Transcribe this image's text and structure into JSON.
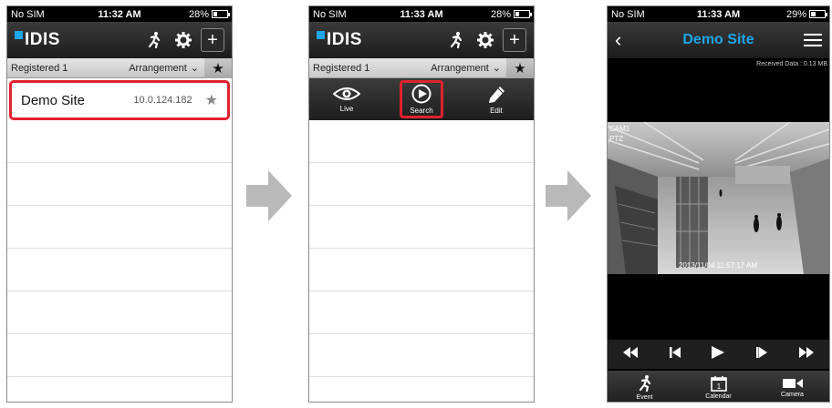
{
  "screen1": {
    "status": {
      "carrier": "No SIM",
      "time": "11:32 AM",
      "battery": "28%",
      "battery_level": 0.28
    },
    "logo": "IDIS",
    "registered": "Registered 1",
    "arrangement": "Arrangement",
    "site": {
      "name": "Demo Site",
      "ip": "10.0.124.182"
    }
  },
  "screen2": {
    "status": {
      "carrier": "No SIM",
      "time": "11:33 AM",
      "battery": "28%",
      "battery_level": 0.28
    },
    "logo": "IDIS",
    "registered": "Registered 1",
    "arrangement": "Arrangement",
    "actions": {
      "live": "Live",
      "search": "Search",
      "edit": "Edit"
    }
  },
  "screen3": {
    "status": {
      "carrier": "No SIM",
      "time": "11:33 AM",
      "battery": "29%",
      "battery_level": 0.29
    },
    "title": "Demo Site",
    "received": "Received Data : 0.13 MB",
    "camera": "CAM1",
    "ptz": "PTZ",
    "timestamp": "2013/11/04   11:57:17 AM",
    "tabs": {
      "event": "Event",
      "calendar": "Calendar",
      "camera": "Camera"
    },
    "calendar_day": "1"
  },
  "colors": {
    "highlight": "#e0222e",
    "accent": "#1ea6e8",
    "arrow": "#b9b9b9"
  }
}
